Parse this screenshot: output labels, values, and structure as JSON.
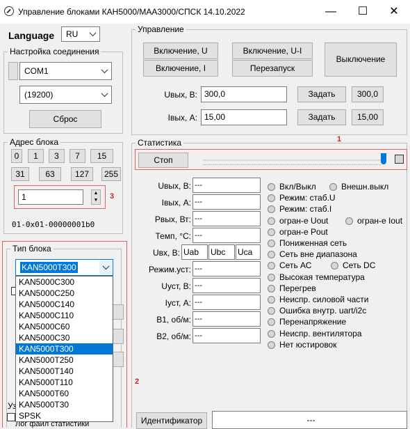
{
  "window": {
    "title": "Управление блоками КАН5000/МАА3000/СПСК 14.10.2022",
    "minimize": "—",
    "maximize": "☐",
    "close": "✕"
  },
  "left": {
    "language_label": "Language",
    "language_value": "RU",
    "conn_group": "Настройка соединения",
    "port": "COM1",
    "baud": "(19200)",
    "reset": "Сброс",
    "addr_group": "Адрес блока",
    "addr_buttons_row1": [
      "0",
      "1",
      "3",
      "7",
      "15"
    ],
    "addr_buttons_row2": [
      "31",
      "63",
      "127",
      "255"
    ],
    "addr_value": "1",
    "addr_marker": "3",
    "addr_hex": "01-0x01-00000001b0",
    "type_group": "Тип блока",
    "type_value": "KAN5000T300",
    "type_options": [
      "KAN5000C300",
      "KAN5000C250",
      "KAN5000C140",
      "KAN5000C110",
      "KAN5000C60",
      "KAN5000C30",
      "KAN5000T300",
      "KAN5000T250",
      "KAN5000T140",
      "KAN5000T110",
      "KAN5000T60",
      "KAN5000T30",
      "SPSK"
    ],
    "type_selected_index": 6,
    "partial_label_u": "Уз",
    "partial_bottom": "Лог файл статистики",
    "marker_2": "2"
  },
  "control": {
    "group": "Управление",
    "on_u": "Включение, U",
    "on_ui": "Включение, U-I",
    "on_i": "Включение, I",
    "restart": "Перезапуск",
    "off": "Выключение",
    "uout_label": "Uвых, В:",
    "uout_value": "300,0",
    "uout_set": "Задать",
    "uout_readback": "300,0",
    "iout_label": "Iвых, А:",
    "iout_value": "15,00",
    "iout_set": "Задать",
    "iout_readback": "15,00"
  },
  "stats": {
    "group": "Статистика",
    "marker_1": "1",
    "stop": "Стоп",
    "fields": [
      {
        "label": "Uвых, В:",
        "value": "---"
      },
      {
        "label": "Iвых, А:",
        "value": "---"
      },
      {
        "label": "Рвых, Вт:",
        "value": "---"
      },
      {
        "label": "Темп, °С:",
        "value": "---"
      }
    ],
    "uvx_label": "Uвх, В:",
    "uvx_values": [
      "Uab",
      "Ubc",
      "Uca"
    ],
    "fields2": [
      {
        "label": "Режим.уст:",
        "value": "---"
      },
      {
        "label": "Uуст, В:",
        "value": "---"
      },
      {
        "label": "Iуст, А:",
        "value": "---"
      },
      {
        "label": "В1, об/м:",
        "value": "---"
      },
      {
        "label": "В2, об/м:",
        "value": "---"
      }
    ],
    "indicators": [
      {
        "a": "Вкл/Выкл",
        "b": "Внешн.выкл"
      },
      {
        "a": "Режим: стаб.U"
      },
      {
        "a": "Режим: стаб.I"
      },
      {
        "a": "огран-е Uout",
        "b": "огран-е Iout"
      },
      {
        "a": "огран-е Pout"
      },
      {
        "a": "Пониженная сеть"
      },
      {
        "a": "Сеть вне диапазона"
      },
      {
        "a": "Сеть АС",
        "b": "Сеть DC"
      },
      {
        "a": "Высокая температура"
      },
      {
        "a": "Перегрев"
      },
      {
        "a": "Неиспр. силовой части"
      },
      {
        "a": "Ошибка внутр. uart/i2c"
      },
      {
        "a": "Перенапряжение"
      },
      {
        "a": "Неиспр. вентилятора"
      },
      {
        "a": "Нет юстировок"
      }
    ],
    "identifier_button": "Идентификатор",
    "identifier_value": "---"
  }
}
